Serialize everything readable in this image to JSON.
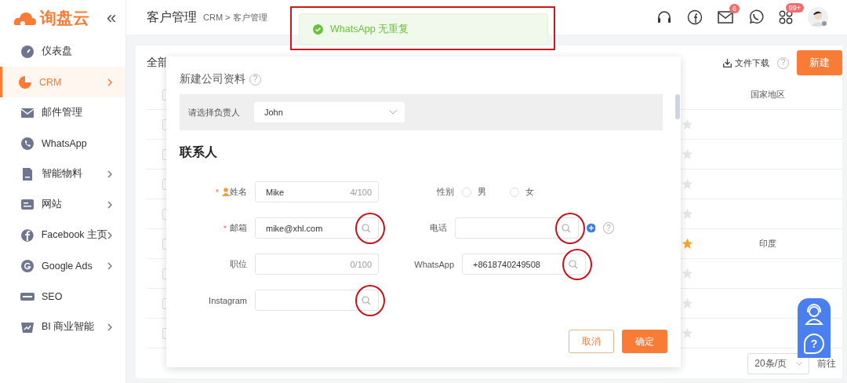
{
  "sidebar": {
    "logo": "询盘云",
    "collapse": "«",
    "items": [
      {
        "label": "仪表盘",
        "selected": false,
        "expandable": false
      },
      {
        "label": "CRM",
        "selected": true,
        "expandable": true
      },
      {
        "label": "邮件管理",
        "selected": false,
        "expandable": false
      },
      {
        "label": "WhatsApp",
        "selected": false,
        "expandable": false
      },
      {
        "label": "智能物料",
        "selected": false,
        "expandable": true
      },
      {
        "label": "网站",
        "selected": false,
        "expandable": true
      },
      {
        "label": "Facebook 主页",
        "selected": false,
        "expandable": true
      },
      {
        "label": "Google Ads",
        "selected": false,
        "expandable": true
      },
      {
        "label": "SEO",
        "selected": false,
        "expandable": false
      },
      {
        "label": "BI 商业智能",
        "selected": false,
        "expandable": true
      }
    ]
  },
  "header": {
    "title": "客户管理",
    "breadcrumb": "CRM > 客户管理",
    "mail_badge": "6",
    "apps_badge": "99+"
  },
  "toast": {
    "text": "WhatsApp 无重复",
    "highlighted": true
  },
  "toolbar": {
    "tab": "全部",
    "download": "文件下载",
    "help": "?",
    "new_button": "新建"
  },
  "help_widget": {
    "help": "?"
  },
  "table": {
    "columns": [
      "国家地区"
    ],
    "select_all": false,
    "rows": [
      {
        "checked": false,
        "starred": false
      },
      {
        "checked": false,
        "starred": false
      },
      {
        "checked": false,
        "starred": false
      },
      {
        "checked": false,
        "starred": false
      },
      {
        "checked": false,
        "starred": true,
        "country": "印度"
      },
      {
        "checked": false,
        "starred": false
      },
      {
        "checked": false,
        "starred": false
      },
      {
        "checked": false,
        "starred": false
      }
    ]
  },
  "pagination": {
    "page_size": "20条/页",
    "goto": "前往"
  },
  "modal": {
    "title": "新建公司资料",
    "title_help": "?",
    "owner_label": "请选择负责人",
    "owner": "John",
    "section": "联系人",
    "rows": [
      [
        {
          "kind": "text",
          "label": "姓名",
          "required": "*",
          "person_icon": true,
          "value": "Mike",
          "counter": "4/100"
        },
        {
          "kind": "radio",
          "label": "性别",
          "options": [
            {
              "label": "男",
              "selected": false
            },
            {
              "label": "女",
              "selected": false
            }
          ]
        }
      ],
      [
        {
          "kind": "text",
          "label": "邮箱",
          "required": "*",
          "value": "mike@xhl.com",
          "search": true,
          "highlighted": true
        },
        {
          "kind": "text",
          "label": "电话",
          "search": true,
          "highlighted": true,
          "add_button": true,
          "help": "?"
        }
      ],
      [
        {
          "kind": "text",
          "label": "职位",
          "counter": "0/100"
        },
        {
          "kind": "text",
          "label": "WhatsApp",
          "value": "+8618740249508",
          "search": true,
          "highlighted": true
        }
      ],
      [
        {
          "kind": "text",
          "label": "Instagram",
          "search": true,
          "highlighted": true
        }
      ]
    ],
    "cancel": "取消",
    "ok": "确定"
  }
}
